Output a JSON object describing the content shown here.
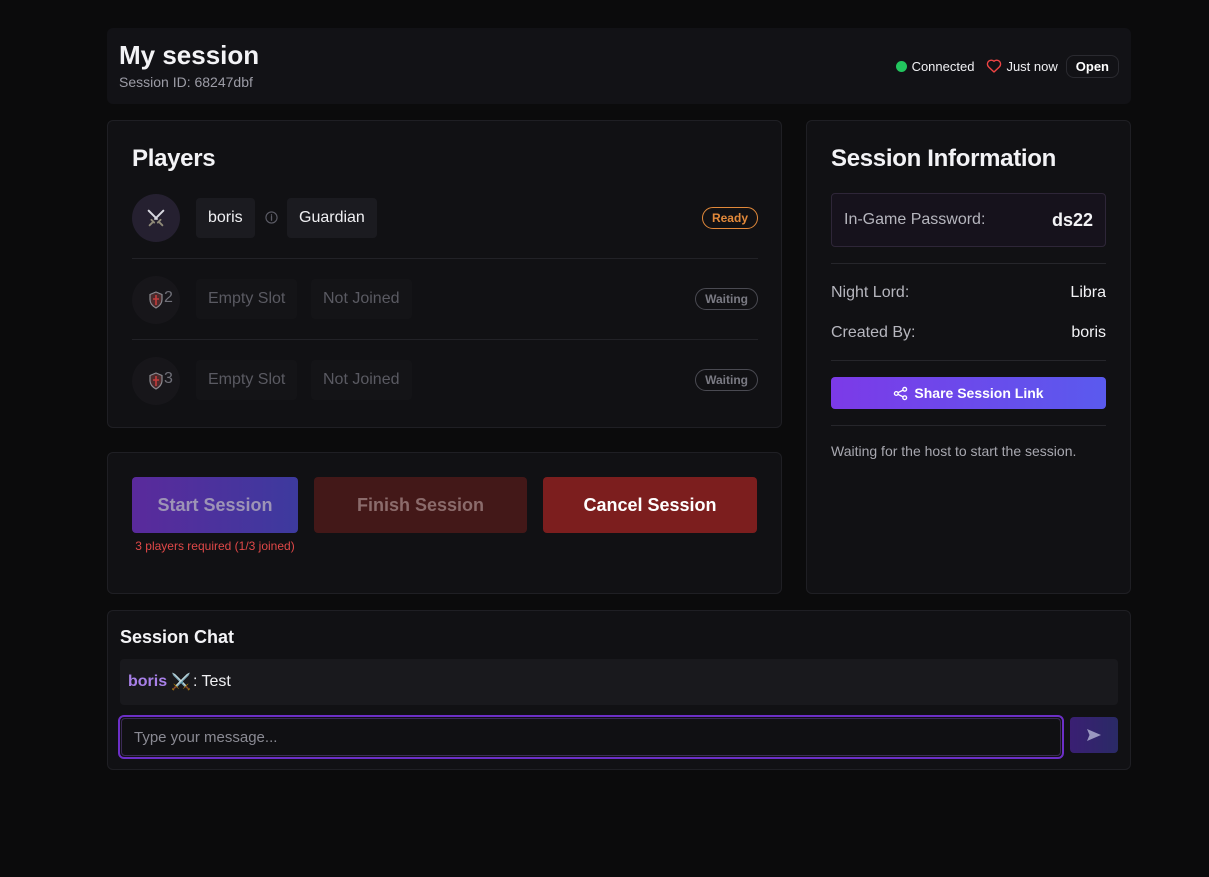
{
  "header": {
    "title": "My session",
    "session_id": "Session ID: 68247dbf",
    "connection": {
      "label": "Connected",
      "color": "#22c55e"
    },
    "heartbeat": {
      "label": "Just now",
      "icon": "heart-icon",
      "color": "#ef4444"
    },
    "state_badge": "Open"
  },
  "players": {
    "title": "Players",
    "rows": [
      {
        "icon": "crossed-swords-icon",
        "slot": "",
        "name": "boris",
        "role": "Guardian",
        "status": "Ready"
      },
      {
        "icon": "shield-icon",
        "slot": "2",
        "name": "Empty Slot",
        "role": "Not Joined",
        "status": "Waiting"
      },
      {
        "icon": "shield-icon",
        "slot": "3",
        "name": "Empty Slot",
        "role": "Not Joined",
        "status": "Waiting"
      }
    ]
  },
  "actions": {
    "start_label": "Start Session",
    "finish_label": "Finish Session",
    "cancel_label": "Cancel Session",
    "start_warning": "3 players required (1/3 joined)"
  },
  "info": {
    "title": "Session Information",
    "password_label": "In-Game Password:",
    "password_value": "ds22",
    "night_lord_label": "Night Lord:",
    "night_lord_value": "Libra",
    "created_by_label": "Created By:",
    "created_by_value": "boris",
    "share_label": "Share Session Link",
    "waiting_note": "Waiting for the host to start the session."
  },
  "chat": {
    "title": "Session Chat",
    "messages": [
      {
        "author": "boris",
        "emoji": "⚔️",
        "separator": ":",
        "text": "Test"
      }
    ],
    "input_placeholder": "Type your message...",
    "input_value": ""
  },
  "colors": {
    "accent": "#7c3ae8",
    "ready": "#e2893a",
    "danger": "#7c1e1e",
    "warning_text": "#e04848"
  }
}
